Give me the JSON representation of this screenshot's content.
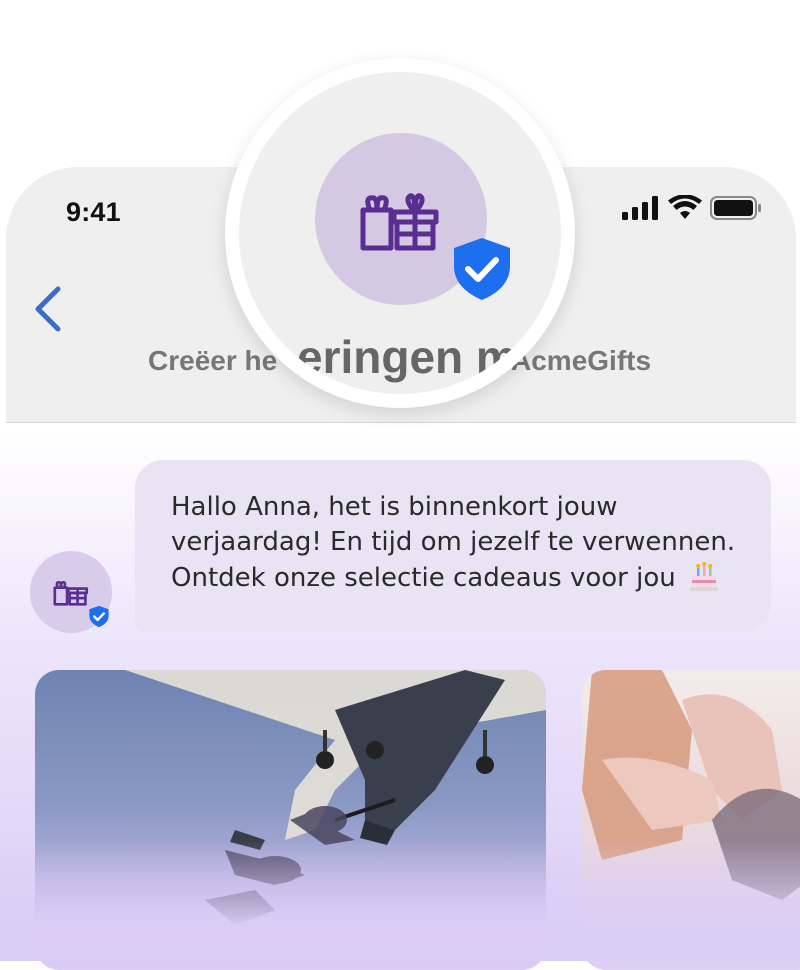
{
  "status_bar": {
    "time": "9:41"
  },
  "header": {
    "back_icon": "chevron-left-icon",
    "title_fragment": "eringen m",
    "subtitle_left": "Creëer he",
    "subtitle_right": "AcmeGifts"
  },
  "sender": {
    "avatar_icon": "gift-icon",
    "verified_icon": "verified-shield-icon"
  },
  "message": {
    "text": "Hallo Anna, het is binnenkort jouw verjaardag! En tijd om jezelf te verwennen. Ontdek onze selectie cadeaus voor jou",
    "emoji_icon": "birthday-cake-icon"
  },
  "cards": [
    {
      "id": "skydive",
      "image_icon": "airplane-skydiver-image"
    },
    {
      "id": "spa",
      "image_icon": "spa-treatment-image"
    }
  ],
  "colors": {
    "accent_purple": "#5a2d91",
    "avatar_bg": "#d4c8e2",
    "verified_blue": "#1e6ff0",
    "back_blue": "#3a6cc8",
    "bubble_bg": "#e9e4f3"
  }
}
